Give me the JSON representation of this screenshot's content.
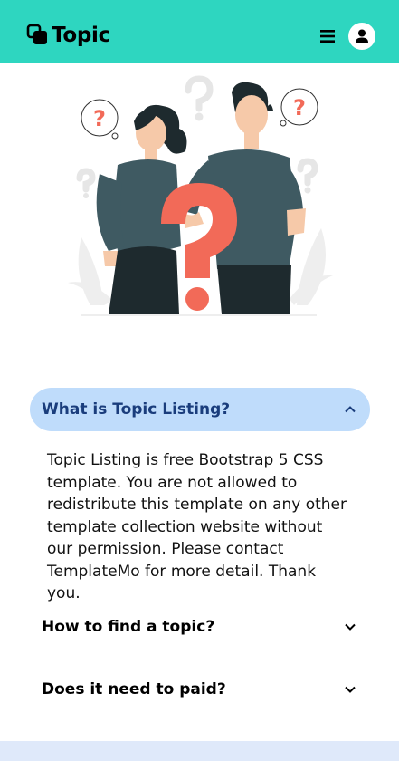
{
  "navbar": {
    "brand": "Topic",
    "menu_icon": "hamburger-icon",
    "user_icon": "user-icon",
    "accent": "#2ed6c0"
  },
  "faq": {
    "items": [
      {
        "question": "What is Topic Listing?",
        "expanded": true,
        "answer": "Topic Listing is free Bootstrap 5 CSS template. You are not allowed to redistribute this template on any other template collection website without our permission. Please contact TemplateMo for more detail. Thank you."
      },
      {
        "question": "How to find a topic?",
        "expanded": false
      },
      {
        "question": "Does it need to paid?",
        "expanded": false
      }
    ],
    "active_bg": "#bfdcfb"
  }
}
